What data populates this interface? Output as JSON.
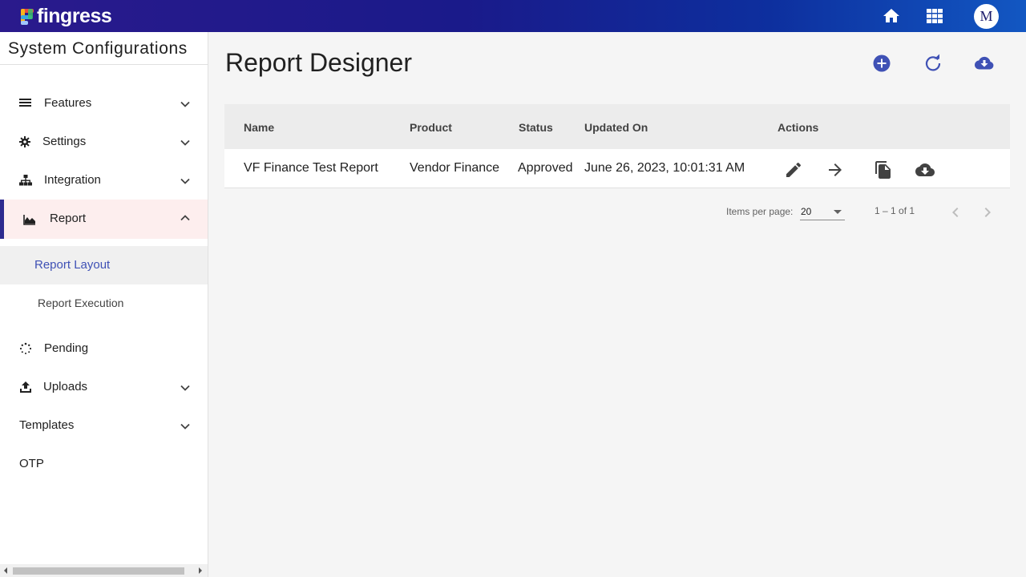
{
  "app": {
    "logo_text": "fingress",
    "avatar_initial": "M",
    "top_icons": [
      "home-icon",
      "apps-grid-icon"
    ]
  },
  "sidebar": {
    "title": "System Configurations",
    "items": [
      {
        "label": "Features",
        "icon": "list-icon",
        "expandable": true
      },
      {
        "label": "Settings",
        "icon": "gear-icon",
        "expandable": true
      },
      {
        "label": "Integration",
        "icon": "hierarchy-icon",
        "expandable": true
      },
      {
        "label": "Report",
        "icon": "area-chart-icon",
        "expandable": true,
        "expanded": true,
        "active": true
      },
      {
        "label": "Pending",
        "icon": "spinner-icon",
        "expandable": false
      },
      {
        "label": "Uploads",
        "icon": "upload-icon",
        "expandable": true
      },
      {
        "label": "Templates",
        "expandable": true
      },
      {
        "label": "OTP",
        "expandable": false
      }
    ],
    "report_children": [
      {
        "label": "Report Layout",
        "selected": true
      },
      {
        "label": "Report Execution",
        "selected": false
      }
    ]
  },
  "main": {
    "title": "Report Designer",
    "header_actions": [
      "add-circle-icon",
      "refresh-icon",
      "cloud-download-icon"
    ],
    "table": {
      "columns": [
        "Name",
        "Product",
        "Status",
        "Updated On",
        "Actions"
      ],
      "rows": [
        {
          "name": "VF Finance Test Report",
          "product": "Vendor Finance",
          "status": "Approved",
          "updated_on": "June 26, 2023, 10:01:31 AM",
          "actions": [
            "edit-icon",
            "arrow-forward-icon",
            "copy-icon",
            "cloud-download-icon"
          ]
        }
      ]
    },
    "paginator": {
      "items_per_page_label": "Items per page:",
      "items_per_page_value": "20",
      "range_label": "1 – 1 of 1"
    }
  },
  "colors": {
    "accent": "#3f51b5",
    "active_bar": "#2e2b8f",
    "active_bg": "#fdeeee",
    "topbar_start": "#2a1a8c",
    "topbar_end": "#1257c2"
  }
}
